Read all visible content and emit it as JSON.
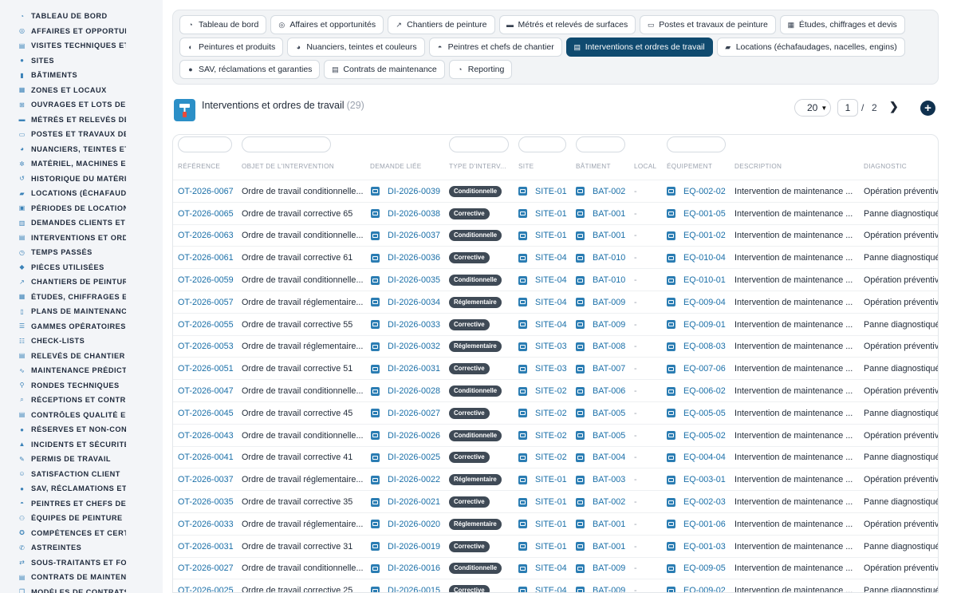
{
  "sidebar": {
    "items": [
      {
        "label": "Tableau de bord",
        "icon": "dashboard-icon"
      },
      {
        "label": "Affaires et opportun",
        "icon": "target-icon"
      },
      {
        "label": "Visites techniques et",
        "icon": "clipboard-icon"
      },
      {
        "label": "Sites",
        "icon": "map-pin-icon"
      },
      {
        "label": "Bâtiments",
        "icon": "building-icon"
      },
      {
        "label": "Zones et locaux",
        "icon": "grid-icon"
      },
      {
        "label": "Ouvrages et lots de t",
        "icon": "sitemap-icon"
      },
      {
        "label": "Métrés et relevés de",
        "icon": "ruler-icon"
      },
      {
        "label": "Postes et travaux de",
        "icon": "paint-roller-icon"
      },
      {
        "label": "Nuanciers, teintes et",
        "icon": "palette-icon"
      },
      {
        "label": "Matériel, machines et",
        "icon": "cogs-icon"
      },
      {
        "label": "Historique du matérie",
        "icon": "history-icon"
      },
      {
        "label": "Locations (échafauda",
        "icon": "truck-icon"
      },
      {
        "label": "Périodes de location",
        "icon": "calendar-icon"
      },
      {
        "label": "Demandes clients et i",
        "icon": "inbox-icon"
      },
      {
        "label": "Interventions et ordi",
        "icon": "clipboard-check-icon"
      },
      {
        "label": "Temps passés",
        "icon": "clock-icon"
      },
      {
        "label": "Pièces utilisées",
        "icon": "box-icon"
      },
      {
        "label": "Chantiers de peintur",
        "icon": "hammer-icon"
      },
      {
        "label": "Études, chiffrages et",
        "icon": "calculator-icon"
      },
      {
        "label": "Plans de maintenance",
        "icon": "file-icon"
      },
      {
        "label": "Gammes opératoires",
        "icon": "list-icon"
      },
      {
        "label": "Check-lists",
        "icon": "checklist-icon"
      },
      {
        "label": "Relevés de chantier",
        "icon": "file-text-icon"
      },
      {
        "label": "Maintenance prédicti",
        "icon": "chart-line-icon"
      },
      {
        "label": "Rondes techniques",
        "icon": "walking-icon"
      },
      {
        "label": "Réceptions et contrô",
        "icon": "search-icon"
      },
      {
        "label": "Contrôles qualité et",
        "icon": "clipboard-icon"
      },
      {
        "label": "Réserves et non-conf",
        "icon": "alert-circle-icon"
      },
      {
        "label": "Incidents et sécurité",
        "icon": "warning-icon"
      },
      {
        "label": "Permis de travail",
        "icon": "file-signature-icon"
      },
      {
        "label": "Satisfaction client",
        "icon": "smile-icon"
      },
      {
        "label": "SAV, réclamations et",
        "icon": "comment-icon"
      },
      {
        "label": "Peintres et chefs de",
        "icon": "hard-hat-icon"
      },
      {
        "label": "Équipes de peinture",
        "icon": "users-icon"
      },
      {
        "label": "Compétences et certi",
        "icon": "certificate-icon"
      },
      {
        "label": "Astreintes",
        "icon": "phone-icon"
      },
      {
        "label": "Sous-traitants et fou",
        "icon": "handshake-icon"
      },
      {
        "label": "Contrats de maintena",
        "icon": "file-contract-icon"
      },
      {
        "label": "Modèles de contrats",
        "icon": "copy-icon"
      }
    ]
  },
  "tabs": {
    "row1": [
      {
        "label": "Tableau de bord",
        "icon": "dashboard-icon"
      },
      {
        "label": "Affaires et opportunités",
        "icon": "target-icon"
      },
      {
        "label": "Chantiers de peinture",
        "icon": "hammer-icon"
      },
      {
        "label": "Métrés et relevés de surfaces",
        "icon": "ruler-icon"
      },
      {
        "label": "Postes et travaux de peinture",
        "icon": "paint-roller-icon"
      },
      {
        "label": "Études, chiffrages et devis",
        "icon": "calculator-icon"
      }
    ],
    "row2": [
      {
        "label": "Peintures et produits",
        "icon": "fill-drip-icon"
      },
      {
        "label": "Nuanciers, teintes et couleurs",
        "icon": "palette-icon"
      },
      {
        "label": "Peintres et chefs de chantier",
        "icon": "hard-hat-icon"
      },
      {
        "label": "Interventions et ordres de travail",
        "icon": "clipboard-check-icon",
        "active": true
      },
      {
        "label": "Locations (échafaudages, nacelles, engins)",
        "icon": "truck-icon"
      }
    ],
    "row3": [
      {
        "label": "SAV, réclamations et garanties",
        "icon": "comment-icon"
      },
      {
        "label": "Contrats de maintenance",
        "icon": "file-contract-icon"
      },
      {
        "label": "Reporting",
        "icon": "chart-pie-icon"
      }
    ]
  },
  "header": {
    "title": "Interventions et ordres de travail",
    "count": "(29)",
    "page_size": "20",
    "page_current": "1",
    "page_sep": "/",
    "page_total": "2",
    "next_icon": "chevron-right-icon",
    "add_icon": "plus-circle-icon"
  },
  "table": {
    "columns": [
      "Référence",
      "Objet de l'intervention",
      "Demande liée",
      "Type d'interv...",
      "Site",
      "Bâtiment",
      "Local",
      "Équipement",
      "Description",
      "Diagnostic"
    ],
    "rows": [
      [
        "OT-2026-0067",
        "Ordre de travail conditionnelle...",
        "DI-2026-0039",
        "Conditionnelle",
        "SITE-01",
        "BAT-002",
        "-",
        "EQ-002-02",
        "Intervention de maintenance ...",
        "Opération préventive"
      ],
      [
        "OT-2026-0065",
        "Ordre de travail corrective 65",
        "DI-2026-0038",
        "Corrective",
        "SITE-01",
        "BAT-001",
        "-",
        "EQ-001-05",
        "Intervention de maintenance ...",
        "Panne diagnostiquée"
      ],
      [
        "OT-2026-0063",
        "Ordre de travail conditionnelle...",
        "DI-2026-0037",
        "Conditionnelle",
        "SITE-01",
        "BAT-001",
        "-",
        "EQ-001-02",
        "Intervention de maintenance ...",
        "Opération préventive"
      ],
      [
        "OT-2026-0061",
        "Ordre de travail corrective 61",
        "DI-2026-0036",
        "Corrective",
        "SITE-04",
        "BAT-010",
        "-",
        "EQ-010-04",
        "Intervention de maintenance ...",
        "Panne diagnostiquée"
      ],
      [
        "OT-2026-0059",
        "Ordre de travail conditionnelle...",
        "DI-2026-0035",
        "Conditionnelle",
        "SITE-04",
        "BAT-010",
        "-",
        "EQ-010-01",
        "Intervention de maintenance ...",
        "Opération préventive"
      ],
      [
        "OT-2026-0057",
        "Ordre de travail réglementaire...",
        "DI-2026-0034",
        "Réglementaire",
        "SITE-04",
        "BAT-009",
        "-",
        "EQ-009-04",
        "Intervention de maintenance ...",
        "Opération préventive"
      ],
      [
        "OT-2026-0055",
        "Ordre de travail corrective 55",
        "DI-2026-0033",
        "Corrective",
        "SITE-04",
        "BAT-009",
        "-",
        "EQ-009-01",
        "Intervention de maintenance ...",
        "Panne diagnostiquée"
      ],
      [
        "OT-2026-0053",
        "Ordre de travail réglementaire...",
        "DI-2026-0032",
        "Réglementaire",
        "SITE-03",
        "BAT-008",
        "-",
        "EQ-008-03",
        "Intervention de maintenance ...",
        "Opération préventive"
      ],
      [
        "OT-2026-0051",
        "Ordre de travail corrective 51",
        "DI-2026-0031",
        "Corrective",
        "SITE-03",
        "BAT-007",
        "-",
        "EQ-007-06",
        "Intervention de maintenance ...",
        "Panne diagnostiquée"
      ],
      [
        "OT-2026-0047",
        "Ordre de travail conditionnelle...",
        "DI-2026-0028",
        "Conditionnelle",
        "SITE-02",
        "BAT-006",
        "-",
        "EQ-006-02",
        "Intervention de maintenance ...",
        "Opération préventive"
      ],
      [
        "OT-2026-0045",
        "Ordre de travail corrective 45",
        "DI-2026-0027",
        "Corrective",
        "SITE-02",
        "BAT-005",
        "-",
        "EQ-005-05",
        "Intervention de maintenance ...",
        "Panne diagnostiquée"
      ],
      [
        "OT-2026-0043",
        "Ordre de travail conditionnelle...",
        "DI-2026-0026",
        "Conditionnelle",
        "SITE-02",
        "BAT-005",
        "-",
        "EQ-005-02",
        "Intervention de maintenance ...",
        "Opération préventive"
      ],
      [
        "OT-2026-0041",
        "Ordre de travail corrective 41",
        "DI-2026-0025",
        "Corrective",
        "SITE-02",
        "BAT-004",
        "-",
        "EQ-004-04",
        "Intervention de maintenance ...",
        "Panne diagnostiquée"
      ],
      [
        "OT-2026-0037",
        "Ordre de travail réglementaire...",
        "DI-2026-0022",
        "Réglementaire",
        "SITE-01",
        "BAT-003",
        "-",
        "EQ-003-01",
        "Intervention de maintenance ...",
        "Opération préventive"
      ],
      [
        "OT-2026-0035",
        "Ordre de travail corrective 35",
        "DI-2026-0021",
        "Corrective",
        "SITE-01",
        "BAT-002",
        "-",
        "EQ-002-03",
        "Intervention de maintenance ...",
        "Panne diagnostiquée"
      ],
      [
        "OT-2026-0033",
        "Ordre de travail réglementaire...",
        "DI-2026-0020",
        "Réglementaire",
        "SITE-01",
        "BAT-001",
        "-",
        "EQ-001-06",
        "Intervention de maintenance ...",
        "Opération préventive"
      ],
      [
        "OT-2026-0031",
        "Ordre de travail corrective 31",
        "DI-2026-0019",
        "Corrective",
        "SITE-01",
        "BAT-001",
        "-",
        "EQ-001-03",
        "Intervention de maintenance ...",
        "Panne diagnostiquée"
      ],
      [
        "OT-2026-0027",
        "Ordre de travail conditionnelle...",
        "DI-2026-0016",
        "Conditionnelle",
        "SITE-04",
        "BAT-009",
        "-",
        "EQ-009-05",
        "Intervention de maintenance ...",
        "Opération préventive"
      ],
      [
        "OT-2026-0025",
        "Ordre de travail corrective 25",
        "DI-2026-0015",
        "Corrective",
        "SITE-04",
        "BAT-009",
        "-",
        "EQ-009-02",
        "Intervention de maintenance ...",
        "Panne diagnostiquée"
      ]
    ]
  },
  "colors": {
    "accent": "#0f4a6f",
    "link": "#1a6fa8",
    "badge": "#3f4a56",
    "sidebar_bg": "#f3f5f8"
  }
}
